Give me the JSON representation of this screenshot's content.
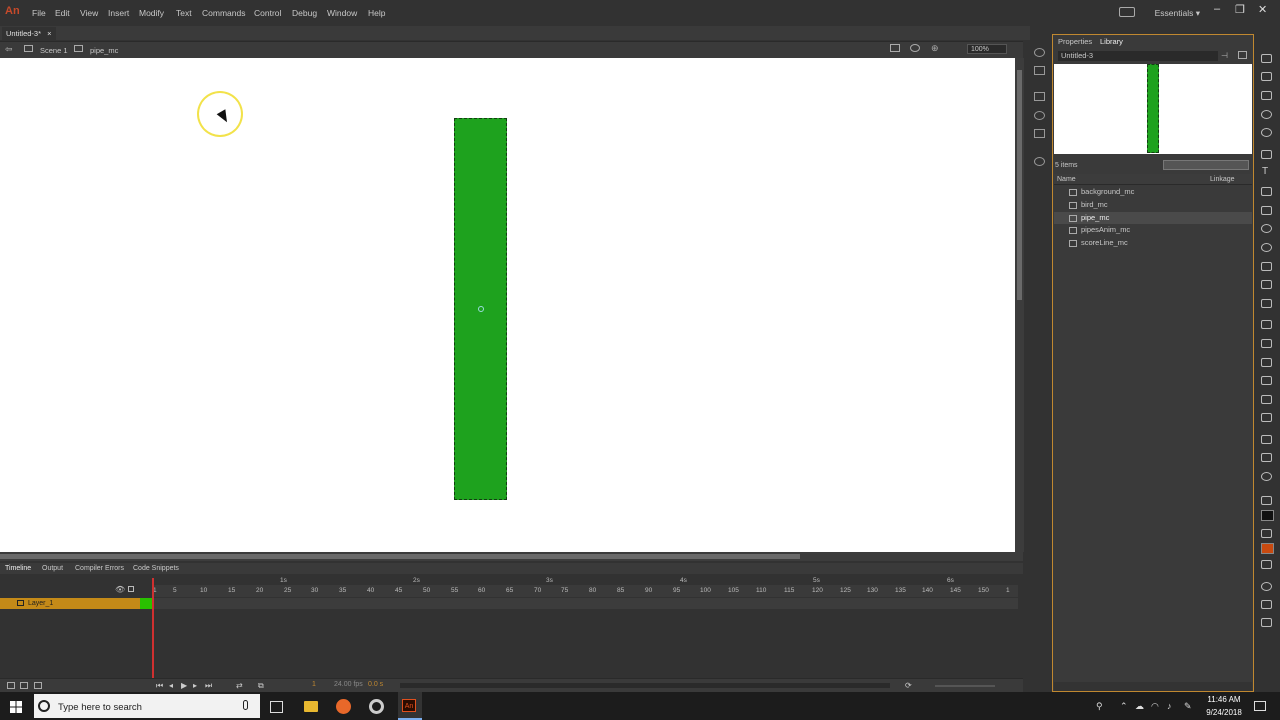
{
  "app": {
    "logo": "An",
    "workspace": "Essentials ▾"
  },
  "menu": [
    "File",
    "Edit",
    "View",
    "Insert",
    "Modify",
    "Text",
    "Commands",
    "Control",
    "Debug",
    "Window",
    "Help"
  ],
  "window_controls": {
    "minimize": "–",
    "restore": "❐",
    "close": "✕"
  },
  "document_tab": {
    "label": "Untitled-3*",
    "close": "×"
  },
  "edit_bar": {
    "scene": "Scene 1",
    "symbol": "pipe_mc",
    "zoom": "100%"
  },
  "panel": {
    "tabs": [
      "Properties",
      "Library"
    ],
    "library_doc": "Untitled-3",
    "item_count": "5 items",
    "columns": {
      "name": "Name",
      "linkage": "Linkage"
    },
    "items": [
      "background_mc",
      "bird_mc",
      "pipe_mc",
      "pipesAnim_mc",
      "scoreLine_mc"
    ],
    "selected_item": "pipe_mc"
  },
  "timeline": {
    "tabs": [
      "Timeline",
      "Output",
      "Compiler Errors",
      "Code Snippets"
    ],
    "layer": "Layer_1",
    "frame_numbers": [
      "1",
      "5",
      "10",
      "15",
      "20",
      "25",
      "30",
      "35",
      "40",
      "45",
      "50",
      "55",
      "60",
      "65",
      "70",
      "75",
      "80",
      "85",
      "90",
      "95",
      "100",
      "105",
      "110",
      "115",
      "120",
      "125",
      "130",
      "135",
      "140",
      "145",
      "150",
      "1"
    ],
    "second_markers": [
      "1s",
      "2s",
      "3s",
      "4s",
      "5s",
      "6s"
    ],
    "current_frame": "1",
    "fps": "24.00 fps",
    "time": "0.0 s"
  },
  "taskbar": {
    "search_placeholder": "Type here to search",
    "time": "11:46 AM",
    "date": "9/24/2018"
  },
  "colors": {
    "pipe": "#1ea21e",
    "panel_border": "#c08830",
    "fill": "#c84a10",
    "stroke": "#111111"
  }
}
